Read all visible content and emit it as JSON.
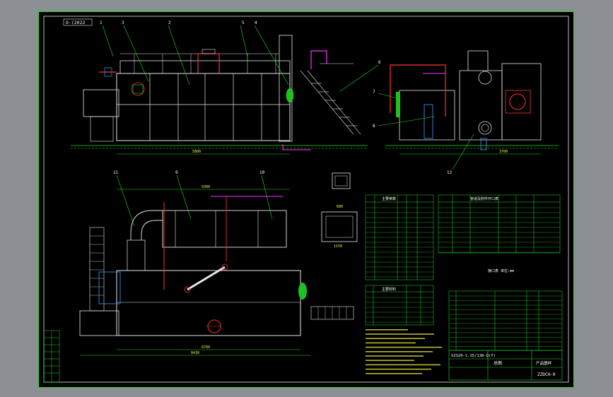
{
  "drawing": {
    "id_tag": "O-(2022",
    "model": "SZS20-1.25/130-Q(Y)",
    "drawing_no": "ZZDCH-0",
    "title_block_label": "总图",
    "revision_label": "产品图样"
  },
  "callouts": [
    "1",
    "2",
    "3",
    "4",
    "5",
    "6",
    "7",
    "8",
    "9",
    "10",
    "11",
    "12"
  ],
  "dims": {
    "front_width": "5800",
    "side_width": "3700",
    "plan_width": "6700",
    "plan_total": "8430",
    "tank_top": "9300",
    "sec_a": "600",
    "sec_b": "1150"
  },
  "tables": {
    "left_header": "主要参数",
    "right_header": "管道及附件开口表",
    "mid_header": "主要材料",
    "parts_note": "接口表 单位:mm"
  }
}
